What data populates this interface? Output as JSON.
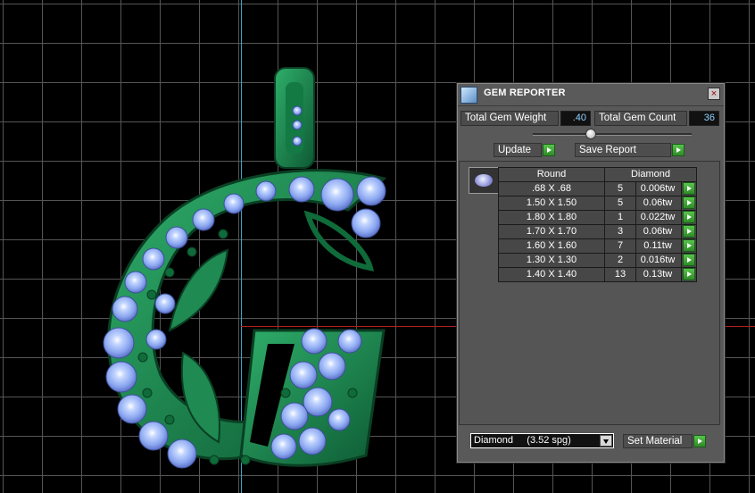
{
  "panel": {
    "title": "GEM REPORTER",
    "close_glyph": "×",
    "total_weight_label": "Total Gem Weight",
    "total_weight_value": ".40",
    "total_count_label": "Total Gem Count",
    "total_count_value": "36",
    "update_label": "Update",
    "save_report_label": "Save Report",
    "table": {
      "col_shape": "Round",
      "col_material": "Diamond",
      "rows": [
        {
          "size": ".68 X .68",
          "count": "5",
          "weight": "0.006tw"
        },
        {
          "size": "1.50 X 1.50",
          "count": "5",
          "weight": "0.06tw"
        },
        {
          "size": "1.80 X 1.80",
          "count": "1",
          "weight": "0.022tw"
        },
        {
          "size": "1.70 X 1.70",
          "count": "3",
          "weight": "0.06tw"
        },
        {
          "size": "1.60 X 1.60",
          "count": "7",
          "weight": "0.11tw"
        },
        {
          "size": "1.30 X 1.30",
          "count": "2",
          "weight": "0.016tw"
        },
        {
          "size": "1.40 X 1.40",
          "count": "13",
          "weight": "0.13tw"
        }
      ]
    },
    "material_select": "Diamond     (3.52 spg)",
    "set_material_label": "Set Material",
    "colors": {
      "accent_green": "#3fa83a",
      "panel_bg": "#595959",
      "value_text": "#8fd1ff"
    }
  },
  "icons": {
    "app": "gem-reporter-icon",
    "gem": "round-gem-icon",
    "action": "green-play-arrow-icon"
  }
}
